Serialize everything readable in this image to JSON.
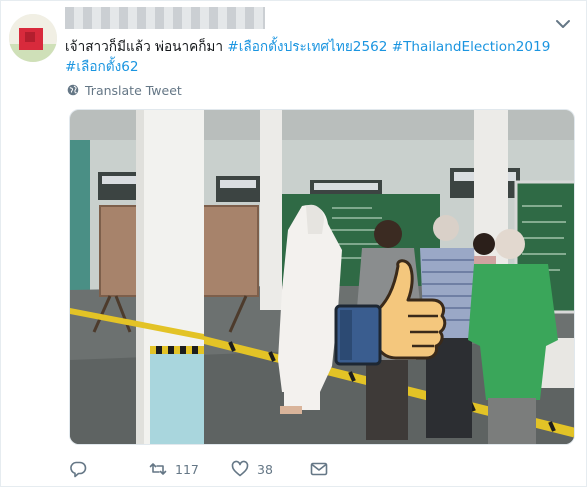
{
  "tweet": {
    "text_main": "เจ้าสาวก็มีแล้ว พ่อนาคก็มา ",
    "hashtags": [
      "#เลือกตั้งประเทศไทย2562",
      "#ThailandElection2019",
      "#เลือกตั้ง62"
    ],
    "translate_label": "Translate Tweet",
    "photo_alt": "Voters inside a polling station with a thumbs-up sticker overlay"
  },
  "actions": {
    "reply_icon": "reply-icon",
    "retweet_count": "117",
    "like_count": "38",
    "dm_icon": "envelope-icon"
  },
  "colors": {
    "hashtag": "#1b95e0",
    "muted": "#657786",
    "text": "#14171a"
  }
}
